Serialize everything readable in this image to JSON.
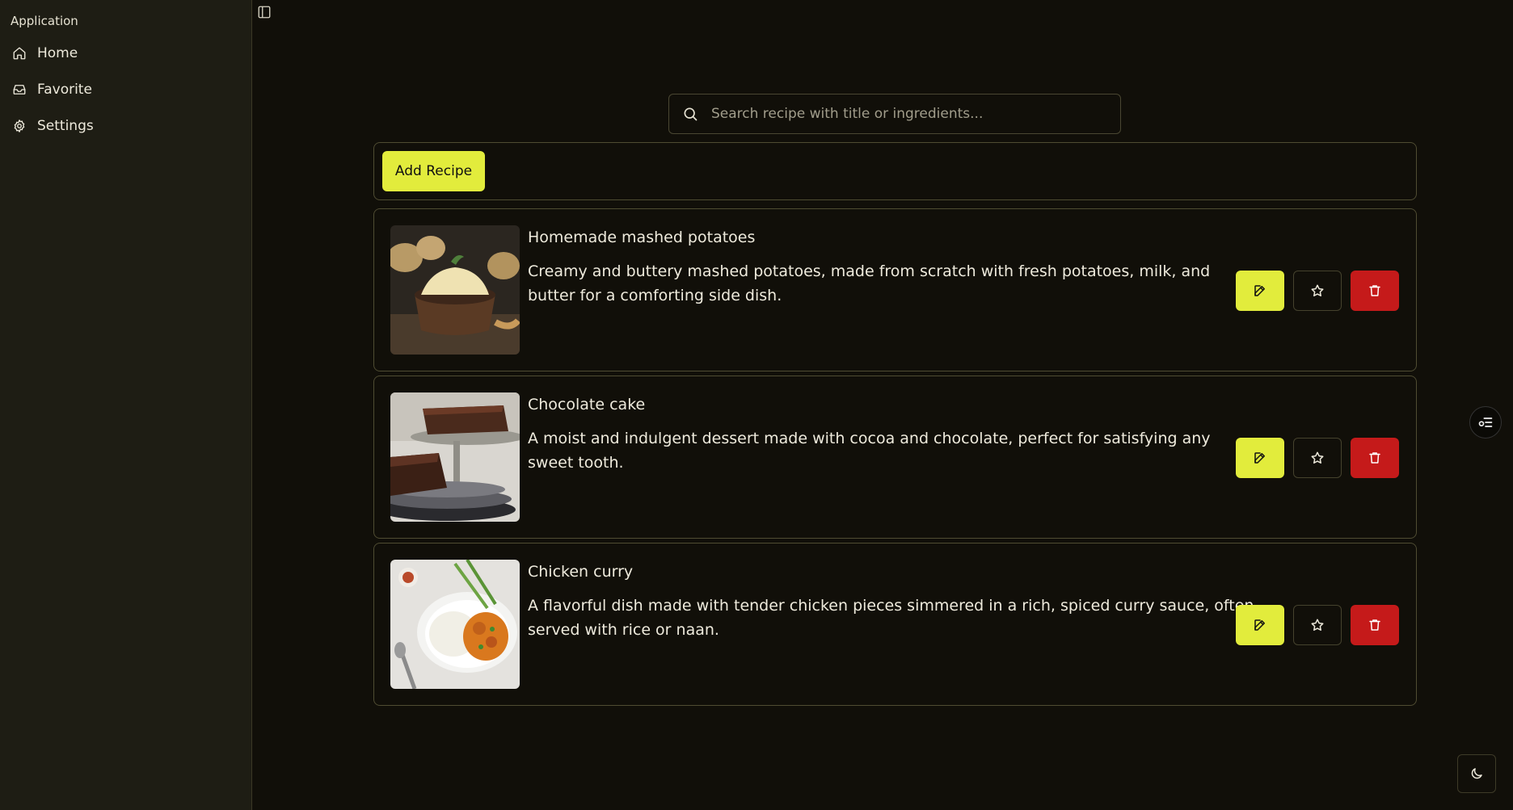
{
  "sidebar": {
    "group_label": "Application",
    "items": [
      {
        "label": "Home",
        "icon": "home-icon"
      },
      {
        "label": "Favorite",
        "icon": "inbox-icon"
      },
      {
        "label": "Settings",
        "icon": "gear-icon"
      }
    ]
  },
  "search": {
    "placeholder": "Search recipe with title or ingredients...",
    "value": ""
  },
  "toolbar": {
    "add_label": "Add Recipe"
  },
  "recipes": [
    {
      "title": "Homemade mashed potatoes",
      "description": "Creamy and buttery mashed potatoes, made from scratch with fresh potatoes, milk, and butter for a comforting side dish.",
      "image": "mashed-potatoes-image"
    },
    {
      "title": "Chocolate cake",
      "description": "A moist and indulgent dessert made with cocoa and chocolate, perfect for satisfying any sweet tooth.",
      "image": "chocolate-cake-image"
    },
    {
      "title": "Chicken curry",
      "description": "A flavorful dish made with tender chicken pieces simmered in a rich, spiced curry sauce, often served with rice or naan.",
      "image": "chicken-curry-image"
    }
  ],
  "colors": {
    "accent": "#e2ec3c",
    "danger": "#c51a1a",
    "background": "#110f09",
    "sidebar": "#1e1d14"
  }
}
